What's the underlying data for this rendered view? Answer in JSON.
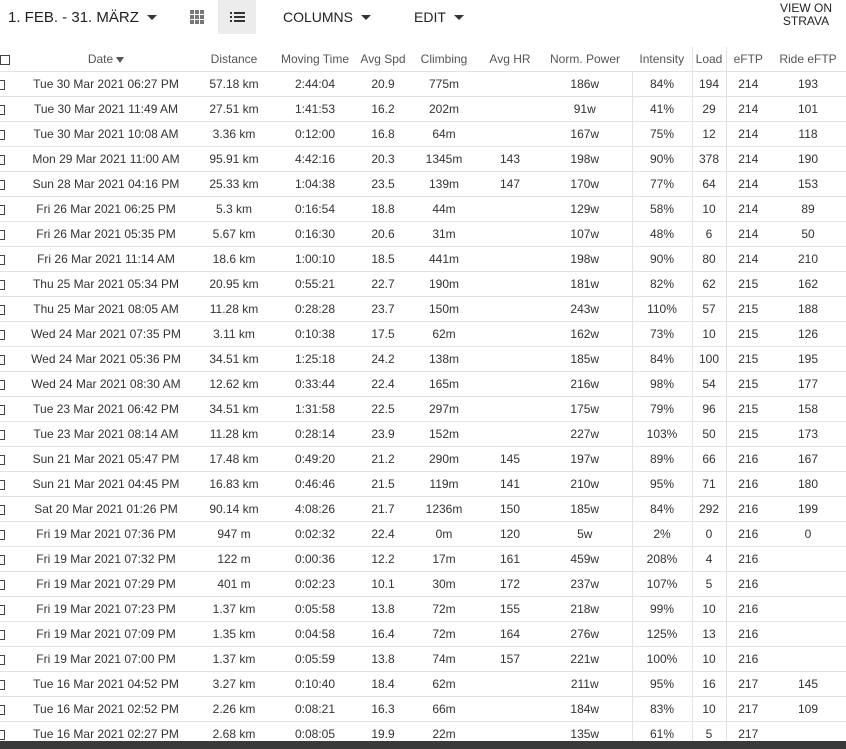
{
  "toolbar": {
    "date_range": "1. FEB. - 31. MÄRZ",
    "columns_label": "COLUMNS",
    "edit_label": "EDIT",
    "strava_line1": "VIEW ON",
    "strava_line2": "STRAVA"
  },
  "table": {
    "headers": {
      "date": "Date",
      "distance": "Distance",
      "moving_time": "Moving Time",
      "avg_spd": "Avg Spd",
      "climbing": "Climbing",
      "avg_hr": "Avg HR",
      "norm_power": "Norm. Power",
      "intensity": "Intensity",
      "load": "Load",
      "eftp": "eFTP",
      "ride_eftp": "Ride eFTP"
    },
    "rows": [
      [
        "Tue 30 Mar 2021 06:27 PM",
        "57.18 km",
        "2:44:04",
        "20.9",
        "775m",
        "",
        "186w",
        "84%",
        "194",
        "214",
        "193"
      ],
      [
        "Tue 30 Mar 2021 11:49 AM",
        "27.51 km",
        "1:41:53",
        "16.2",
        "202m",
        "",
        "91w",
        "41%",
        "29",
        "214",
        "101"
      ],
      [
        "Tue 30 Mar 2021 10:08 AM",
        "3.36 km",
        "0:12:00",
        "16.8",
        "64m",
        "",
        "167w",
        "75%",
        "12",
        "214",
        "118"
      ],
      [
        "Mon 29 Mar 2021 11:00 AM",
        "95.91 km",
        "4:42:16",
        "20.3",
        "1345m",
        "143",
        "198w",
        "90%",
        "378",
        "214",
        "190"
      ],
      [
        "Sun 28 Mar 2021 04:16 PM",
        "25.33 km",
        "1:04:38",
        "23.5",
        "139m",
        "147",
        "170w",
        "77%",
        "64",
        "214",
        "153"
      ],
      [
        "Fri 26 Mar 2021 06:25 PM",
        "5.3 km",
        "0:16:54",
        "18.8",
        "44m",
        "",
        "129w",
        "58%",
        "10",
        "214",
        "89"
      ],
      [
        "Fri 26 Mar 2021 05:35 PM",
        "5.67 km",
        "0:16:30",
        "20.6",
        "31m",
        "",
        "107w",
        "48%",
        "6",
        "214",
        "50"
      ],
      [
        "Fri 26 Mar 2021 11:14 AM",
        "18.6 km",
        "1:00:10",
        "18.5",
        "441m",
        "",
        "198w",
        "90%",
        "80",
        "214",
        "210"
      ],
      [
        "Thu 25 Mar 2021 05:34 PM",
        "20.95 km",
        "0:55:21",
        "22.7",
        "190m",
        "",
        "181w",
        "82%",
        "62",
        "215",
        "162"
      ],
      [
        "Thu 25 Mar 2021 08:05 AM",
        "11.28 km",
        "0:28:28",
        "23.7",
        "150m",
        "",
        "243w",
        "110%",
        "57",
        "215",
        "188"
      ],
      [
        "Wed 24 Mar 2021 07:35 PM",
        "3.11 km",
        "0:10:38",
        "17.5",
        "62m",
        "",
        "162w",
        "73%",
        "10",
        "215",
        "126"
      ],
      [
        "Wed 24 Mar 2021 05:36 PM",
        "34.51 km",
        "1:25:18",
        "24.2",
        "138m",
        "",
        "185w",
        "84%",
        "100",
        "215",
        "195"
      ],
      [
        "Wed 24 Mar 2021 08:30 AM",
        "12.62 km",
        "0:33:44",
        "22.4",
        "165m",
        "",
        "216w",
        "98%",
        "54",
        "215",
        "177"
      ],
      [
        "Tue 23 Mar 2021 06:42 PM",
        "34.51 km",
        "1:31:58",
        "22.5",
        "297m",
        "",
        "175w",
        "79%",
        "96",
        "215",
        "158"
      ],
      [
        "Tue 23 Mar 2021 08:14 AM",
        "11.28 km",
        "0:28:14",
        "23.9",
        "152m",
        "",
        "227w",
        "103%",
        "50",
        "215",
        "173"
      ],
      [
        "Sun 21 Mar 2021 05:47 PM",
        "17.48 km",
        "0:49:20",
        "21.2",
        "290m",
        "145",
        "197w",
        "89%",
        "66",
        "216",
        "167"
      ],
      [
        "Sun 21 Mar 2021 04:45 PM",
        "16.83 km",
        "0:46:46",
        "21.5",
        "119m",
        "141",
        "210w",
        "95%",
        "71",
        "216",
        "180"
      ],
      [
        "Sat 20 Mar 2021 01:26 PM",
        "90.14 km",
        "4:08:26",
        "21.7",
        "1236m",
        "150",
        "185w",
        "84%",
        "292",
        "216",
        "199"
      ],
      [
        "Fri 19 Mar 2021 07:36 PM",
        "947 m",
        "0:02:32",
        "22.4",
        "0m",
        "120",
        "5w",
        "2%",
        "0",
        "216",
        "0"
      ],
      [
        "Fri 19 Mar 2021 07:32 PM",
        "122 m",
        "0:00:36",
        "12.2",
        "17m",
        "161",
        "459w",
        "208%",
        "4",
        "216",
        ""
      ],
      [
        "Fri 19 Mar 2021 07:29 PM",
        "401 m",
        "0:02:23",
        "10.1",
        "30m",
        "172",
        "237w",
        "107%",
        "5",
        "216",
        ""
      ],
      [
        "Fri 19 Mar 2021 07:23 PM",
        "1.37 km",
        "0:05:58",
        "13.8",
        "72m",
        "155",
        "218w",
        "99%",
        "10",
        "216",
        ""
      ],
      [
        "Fri 19 Mar 2021 07:09 PM",
        "1.35 km",
        "0:04:58",
        "16.4",
        "72m",
        "164",
        "276w",
        "125%",
        "13",
        "216",
        ""
      ],
      [
        "Fri 19 Mar 2021 07:00 PM",
        "1.37 km",
        "0:05:59",
        "13.8",
        "74m",
        "157",
        "221w",
        "100%",
        "10",
        "216",
        ""
      ],
      [
        "Tue 16 Mar 2021 04:52 PM",
        "3.27 km",
        "0:10:40",
        "18.4",
        "62m",
        "",
        "211w",
        "95%",
        "16",
        "217",
        "145"
      ],
      [
        "Tue 16 Mar 2021 02:52 PM",
        "2.26 km",
        "0:08:21",
        "16.3",
        "66m",
        "",
        "184w",
        "83%",
        "10",
        "217",
        "109"
      ],
      [
        "Tue 16 Mar 2021 02:27 PM",
        "2.68 km",
        "0:08:05",
        "19.9",
        "22m",
        "",
        "135w",
        "61%",
        "5",
        "217",
        ""
      ]
    ]
  }
}
